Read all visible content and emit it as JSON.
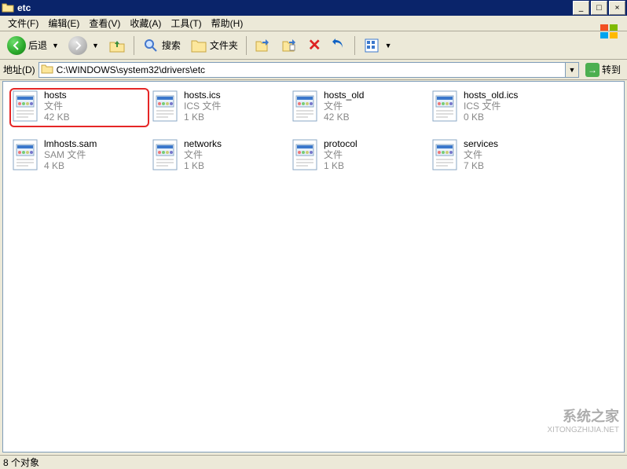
{
  "title": "etc",
  "menu": {
    "file": "文件(F)",
    "edit": "编辑(E)",
    "view": "查看(V)",
    "favorites": "收藏(A)",
    "tools": "工具(T)",
    "help": "帮助(H)"
  },
  "toolbar": {
    "back": "后退",
    "search": "搜索",
    "folders": "文件夹"
  },
  "address": {
    "label": "地址(D)",
    "path": "C:\\WINDOWS\\system32\\drivers\\etc",
    "go": "转到"
  },
  "files": [
    {
      "name": "hosts",
      "type": "文件",
      "size": "42 KB",
      "highlight": true
    },
    {
      "name": "hosts.ics",
      "type": "ICS 文件",
      "size": "1 KB",
      "highlight": false
    },
    {
      "name": "hosts_old",
      "type": "文件",
      "size": "42 KB",
      "highlight": false
    },
    {
      "name": "hosts_old.ics",
      "type": "ICS 文件",
      "size": "0 KB",
      "highlight": false
    },
    {
      "name": "lmhosts.sam",
      "type": "SAM 文件",
      "size": "4 KB",
      "highlight": false
    },
    {
      "name": "networks",
      "type": "文件",
      "size": "1 KB",
      "highlight": false
    },
    {
      "name": "protocol",
      "type": "文件",
      "size": "1 KB",
      "highlight": false
    },
    {
      "name": "services",
      "type": "文件",
      "size": "7 KB",
      "highlight": false
    }
  ],
  "status": "8 个对象",
  "watermark": {
    "cn": "系统之家",
    "url": "XITONGZHIJIA.NET"
  }
}
